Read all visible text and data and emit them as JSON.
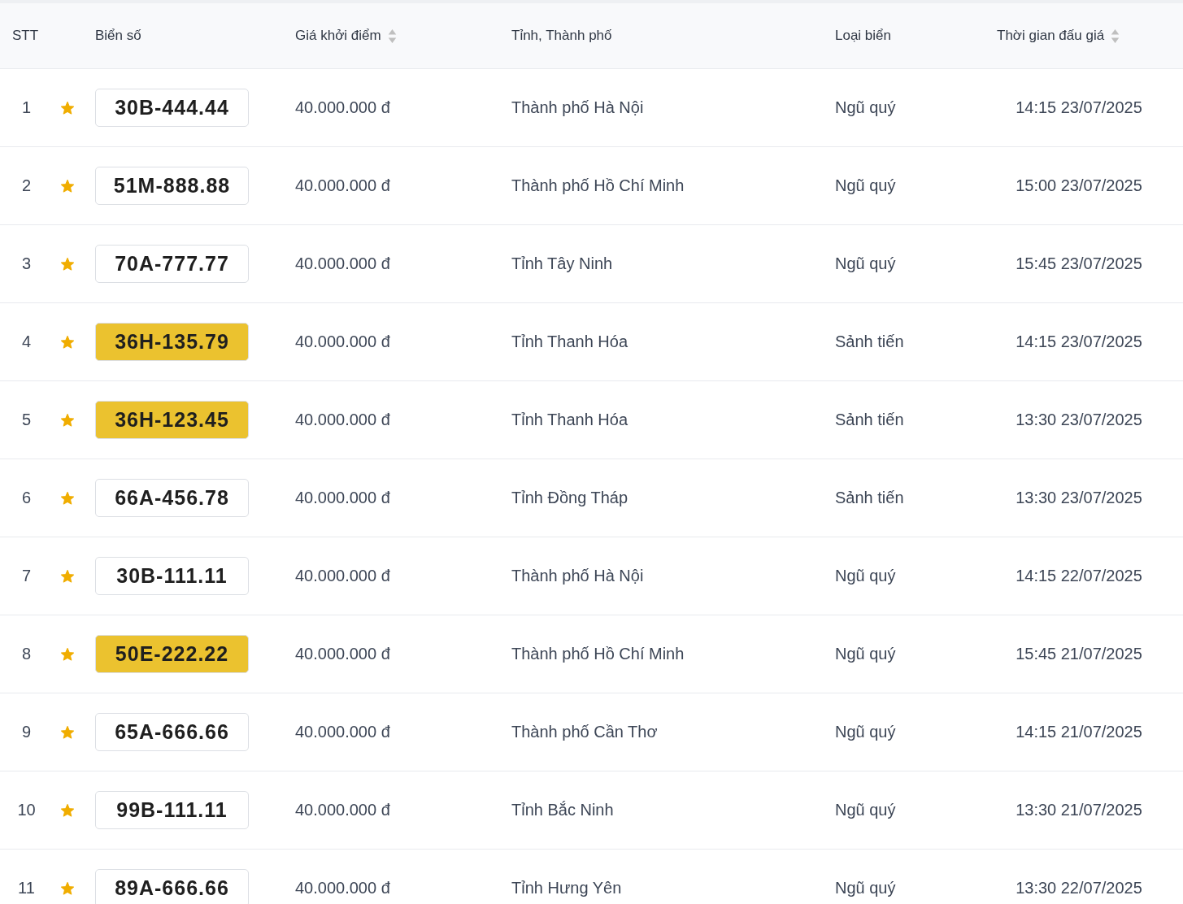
{
  "table": {
    "columns": [
      {
        "label": "STT",
        "sortable": false
      },
      {
        "label": "Biển số",
        "sortable": false
      },
      {
        "label": "Giá khởi điểm",
        "sortable": true
      },
      {
        "label": "Tỉnh, Thành phố",
        "sortable": false
      },
      {
        "label": "Loại biển",
        "sortable": false
      },
      {
        "label": "Thời gian đấu giá",
        "sortable": true
      }
    ],
    "rows": [
      {
        "index": "1",
        "starred": true,
        "plate": "30B-444.44",
        "color": "#ffffff",
        "price": "40.000.000 đ",
        "province": "Thành phố Hà Nội",
        "type": "Ngũ quý",
        "time": "14:15 23/07/2025"
      },
      {
        "index": "2",
        "starred": true,
        "plate": "51M-888.88",
        "color": "#ffffff",
        "price": "40.000.000 đ",
        "province": "Thành phố Hồ Chí Minh",
        "type": "Ngũ quý",
        "time": "15:00 23/07/2025"
      },
      {
        "index": "3",
        "starred": true,
        "plate": "70A-777.77",
        "color": "#ffffff",
        "price": "40.000.000 đ",
        "province": "Tỉnh Tây Ninh",
        "type": "Ngũ quý",
        "time": "15:45 23/07/2025"
      },
      {
        "index": "4",
        "starred": true,
        "plate": "36H-135.79",
        "color": "#ebc22f",
        "price": "40.000.000 đ",
        "province": "Tỉnh Thanh Hóa",
        "type": "Sảnh tiến",
        "time": "14:15 23/07/2025"
      },
      {
        "index": "5",
        "starred": true,
        "plate": "36H-123.45",
        "color": "#ebc22f",
        "price": "40.000.000 đ",
        "province": "Tỉnh Thanh Hóa",
        "type": "Sảnh tiến",
        "time": "13:30 23/07/2025"
      },
      {
        "index": "6",
        "starred": true,
        "plate": "66A-456.78",
        "color": "#ffffff",
        "price": "40.000.000 đ",
        "province": "Tỉnh Đồng Tháp",
        "type": "Sảnh tiến",
        "time": "13:30 23/07/2025"
      },
      {
        "index": "7",
        "starred": true,
        "plate": "30B-111.11",
        "color": "#ffffff",
        "price": "40.000.000 đ",
        "province": "Thành phố Hà Nội",
        "type": "Ngũ quý",
        "time": "14:15 22/07/2025"
      },
      {
        "index": "8",
        "starred": true,
        "plate": "50E-222.22",
        "color": "#ebc22f",
        "price": "40.000.000 đ",
        "province": "Thành phố Hồ Chí Minh",
        "type": "Ngũ quý",
        "time": "15:45 21/07/2025"
      },
      {
        "index": "9",
        "starred": true,
        "plate": "65A-666.66",
        "color": "#ffffff",
        "price": "40.000.000 đ",
        "province": "Thành phố Cần Thơ",
        "type": "Ngũ quý",
        "time": "14:15 21/07/2025"
      },
      {
        "index": "10",
        "starred": true,
        "plate": "99B-111.11",
        "color": "#ffffff",
        "price": "40.000.000 đ",
        "province": "Tỉnh Bắc Ninh",
        "type": "Ngũ quý",
        "time": "13:30 21/07/2025"
      },
      {
        "index": "11",
        "starred": true,
        "plate": "89A-666.66",
        "color": "#ffffff",
        "price": "40.000.000 đ",
        "province": "Tỉnh Hưng Yên",
        "type": "Ngũ quý",
        "time": "13:30 22/07/2025"
      }
    ]
  }
}
